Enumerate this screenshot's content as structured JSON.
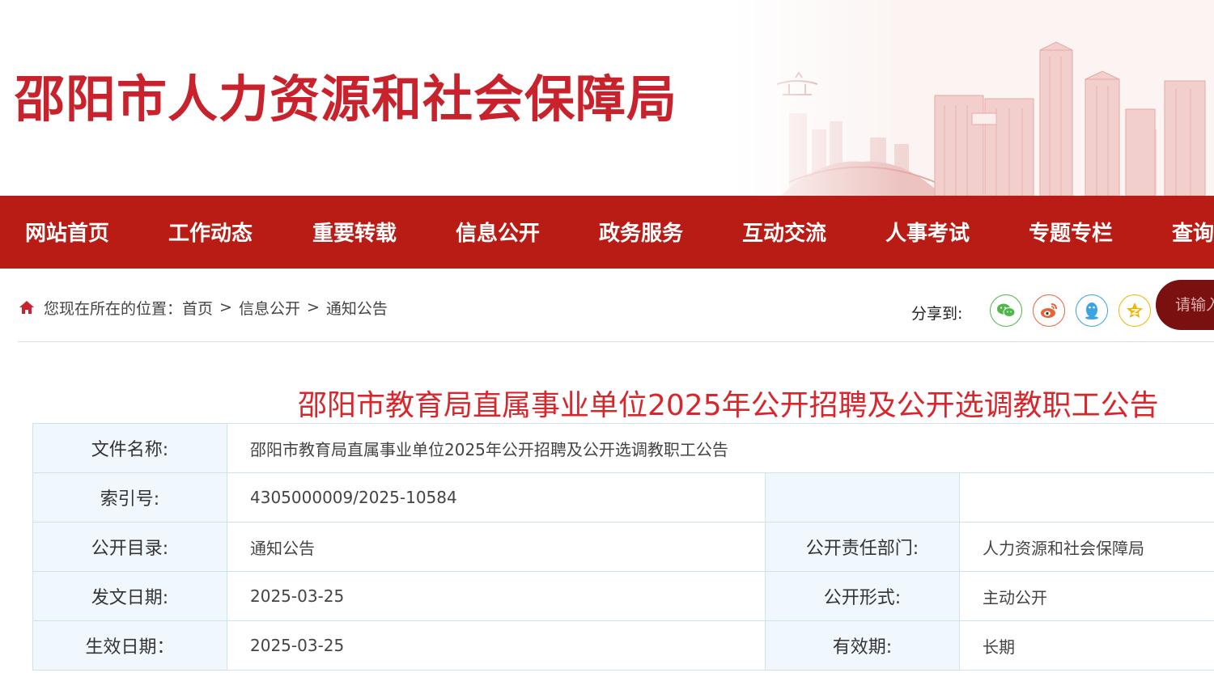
{
  "header": {
    "site_title": "邵阳市人力资源和社会保障局"
  },
  "nav": {
    "items": [
      {
        "label": "网站首页"
      },
      {
        "label": "工作动态"
      },
      {
        "label": "重要转载"
      },
      {
        "label": "信息公开"
      },
      {
        "label": "政务服务"
      },
      {
        "label": "互动交流"
      },
      {
        "label": "人事考试"
      },
      {
        "label": "专题专栏"
      },
      {
        "label": "查询"
      }
    ]
  },
  "breadcrumb": {
    "prefix": "您现在所在的位置：",
    "items": [
      "首页",
      "信息公开",
      "通知公告"
    ],
    "separator": ">"
  },
  "share": {
    "label": "分享到:",
    "buttons": [
      {
        "name": "wechat",
        "color": "#4cb847"
      },
      {
        "name": "weibo",
        "color": "#e8623a"
      },
      {
        "name": "qq",
        "color": "#3aa3e3"
      },
      {
        "name": "qzone",
        "color": "#f0b400"
      }
    ]
  },
  "search": {
    "placeholder": "请输入"
  },
  "article": {
    "title": "邵阳市教育局直属事业单位2025年公开招聘及公开选调教职工公告"
  },
  "meta": {
    "file_name_label": "文件名称:",
    "file_name_value": "邵阳市教育局直属事业单位2025年公开招聘及公开选调教职工公告",
    "index_label": "索引号:",
    "index_value": "4305000009/2025-10584",
    "catalog_label": "公开目录:",
    "catalog_value": "通知公告",
    "dept_label": "公开责任部门:",
    "dept_value": "人力资源和社会保障局",
    "issue_date_label": "发文日期:",
    "issue_date_value": "2025-03-25",
    "form_label": "公开形式:",
    "form_value": "主动公开",
    "effective_date_label": "生效日期：",
    "effective_date_value": "2025-03-25",
    "validity_label": "有效期:",
    "validity_value": "长期"
  },
  "colors": {
    "brand_red": "#c8232c",
    "nav_red": "#b91c15",
    "table_border": "#cfe3ee",
    "table_key_bg": "#f1f8fd"
  }
}
